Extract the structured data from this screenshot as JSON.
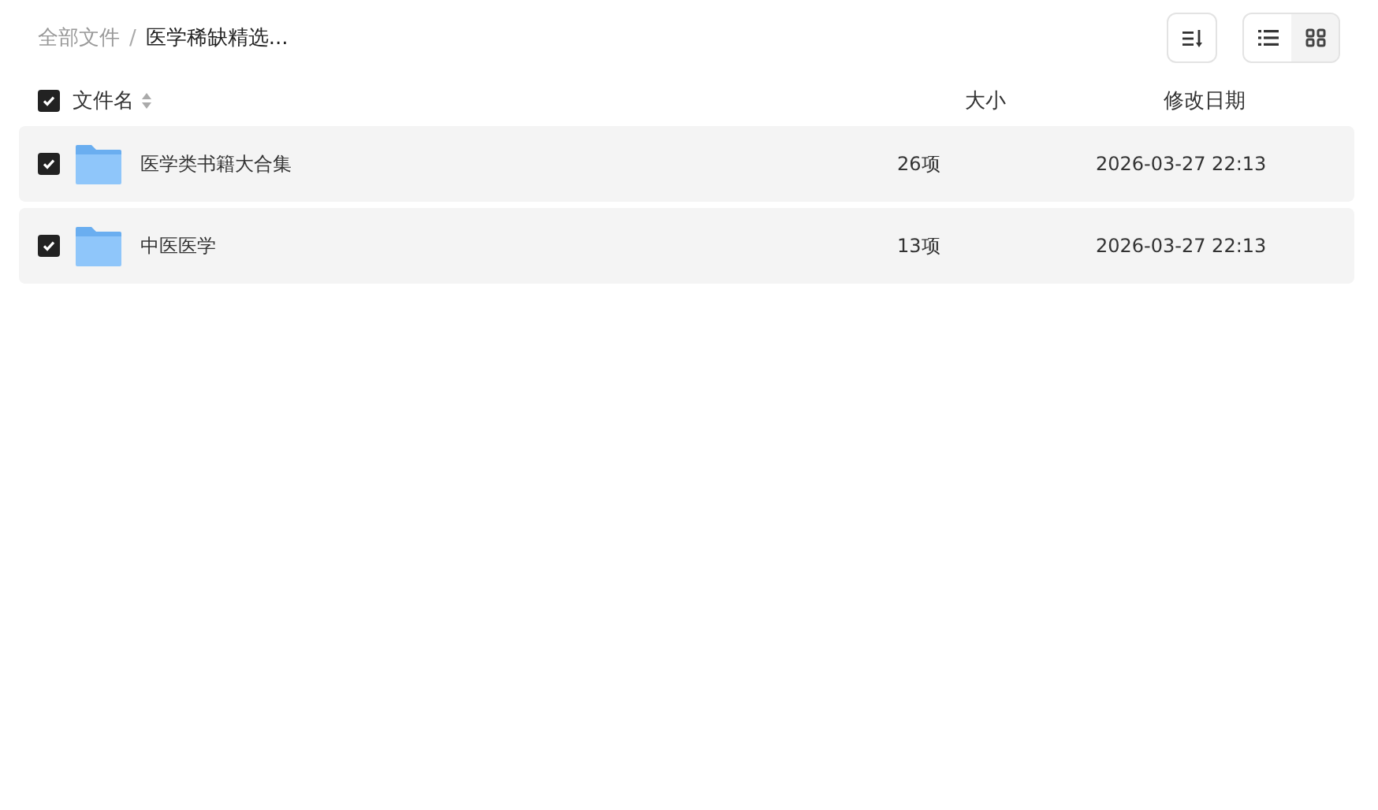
{
  "breadcrumb": [
    {
      "label": "全部文件",
      "current": false
    },
    {
      "label": "医学稀缺精选...",
      "current": true
    }
  ],
  "breadcrumb_separator": "/",
  "view_modes": [
    {
      "kind": "list",
      "selected": true
    },
    {
      "kind": "grid",
      "selected": false
    }
  ],
  "table": {
    "select_all": {
      "checked": true
    },
    "columns": [
      "文件名",
      "大小",
      "修改日期"
    ],
    "rows": [
      {
        "name": "医学类书籍大合集",
        "size": "26项",
        "modified": "2026-03-27 22:13",
        "checked": true
      },
      {
        "name": "中医医学",
        "size": "13项",
        "modified": "2026-03-27 22:13",
        "checked": true
      }
    ]
  }
}
